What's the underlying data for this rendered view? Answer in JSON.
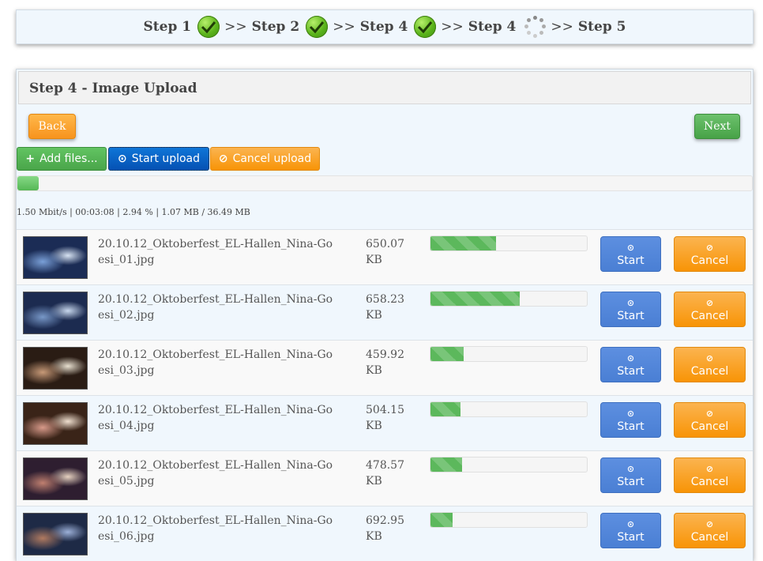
{
  "steps": [
    {
      "label": "Step 1",
      "state": "done"
    },
    {
      "label": "Step 2",
      "state": "done"
    },
    {
      "label": "Step 4",
      "state": "done"
    },
    {
      "label": "Step 4",
      "state": "loading"
    },
    {
      "label": "Step 5",
      "state": "pending"
    }
  ],
  "step_separator": ">>",
  "panel": {
    "title": "Step 4 - Image Upload",
    "back_label": "Back",
    "next_label": "Next"
  },
  "toolbar": {
    "add_label": "Add files...",
    "start_label": "Start upload",
    "cancel_label": "Cancel upload",
    "add_icon": "+",
    "start_icon": "⊙",
    "cancel_icon": "⊘"
  },
  "global_progress_percent": 2.94,
  "global_stats": "1.50 Mbit/s | 00:03:08 | 2.94 % | 1.07 MB / 36.49 MB",
  "row_buttons": {
    "start_label": "Start",
    "cancel_label": "Cancel",
    "start_icon": "⊙",
    "cancel_icon": "⊘"
  },
  "files": [
    {
      "name": "20.10.12_Oktoberfest_EL-Hallen_Nina-Goesi_01.jpg",
      "size": "650.07 KB",
      "progress": 42
    },
    {
      "name": "20.10.12_Oktoberfest_EL-Hallen_Nina-Goesi_02.jpg",
      "size": "658.23 KB",
      "progress": 57
    },
    {
      "name": "20.10.12_Oktoberfest_EL-Hallen_Nina-Goesi_03.jpg",
      "size": "459.92 KB",
      "progress": 21
    },
    {
      "name": "20.10.12_Oktoberfest_EL-Hallen_Nina-Goesi_04.jpg",
      "size": "504.15 KB",
      "progress": 19
    },
    {
      "name": "20.10.12_Oktoberfest_EL-Hallen_Nina-Goesi_05.jpg",
      "size": "478.57 KB",
      "progress": 20
    },
    {
      "name": "20.10.12_Oktoberfest_EL-Hallen_Nina-Goesi_06.jpg",
      "size": "692.95 KB",
      "progress": 14
    }
  ],
  "colors": {
    "success": "#5cb85c",
    "warning": "#f89406",
    "primary": "#0551b3",
    "info": "#4a7fd4"
  }
}
